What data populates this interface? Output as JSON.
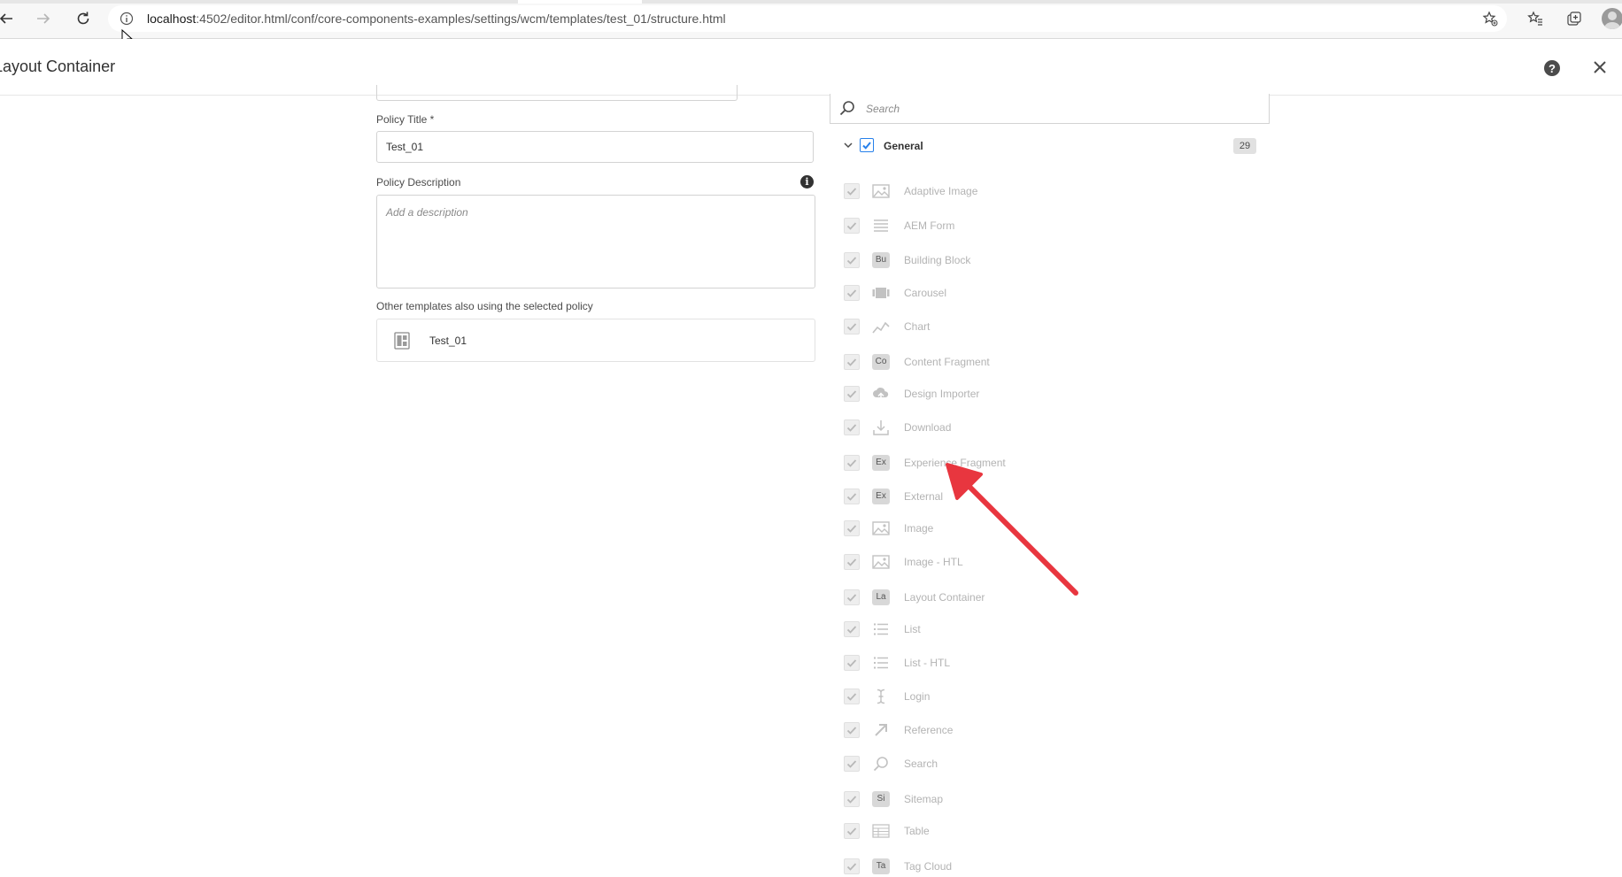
{
  "browser": {
    "url_host": "localhost",
    "url_rest": ":4502/editor.html/conf/core-components-examples/settings/wcm/templates/test_01/structure.html"
  },
  "dialog": {
    "title": "Layout Container"
  },
  "form": {
    "policy_title_label": "Policy Title *",
    "policy_title_value": "Test_01",
    "policy_description_label": "Policy Description",
    "policy_description_placeholder": "Add a description",
    "other_templates_label": "Other templates also using the selected policy",
    "other_templates": [
      {
        "name": "Test_01"
      }
    ]
  },
  "components": {
    "search_placeholder": "Search",
    "group": {
      "name": "General",
      "count": "29",
      "checked": true
    },
    "items": [
      {
        "label": "Adaptive Image",
        "icon": "image-icon",
        "abbr": ""
      },
      {
        "label": "AEM Form",
        "icon": "form-icon",
        "abbr": ""
      },
      {
        "label": "Building Block",
        "icon": "abbr",
        "abbr": "Bu"
      },
      {
        "label": "Carousel",
        "icon": "carousel-icon",
        "abbr": ""
      },
      {
        "label": "Chart",
        "icon": "chart-icon",
        "abbr": ""
      },
      {
        "label": "Content Fragment",
        "icon": "abbr",
        "abbr": "Co"
      },
      {
        "label": "Design Importer",
        "icon": "cloud-upload-icon",
        "abbr": ""
      },
      {
        "label": "Download",
        "icon": "download-icon",
        "abbr": ""
      },
      {
        "label": "Experience Fragment",
        "icon": "abbr",
        "abbr": "Ex"
      },
      {
        "label": "External",
        "icon": "abbr",
        "abbr": "Ex"
      },
      {
        "label": "Image",
        "icon": "image-icon",
        "abbr": ""
      },
      {
        "label": "Image - HTL",
        "icon": "image-icon",
        "abbr": ""
      },
      {
        "label": "Layout Container",
        "icon": "abbr",
        "abbr": "La"
      },
      {
        "label": "List",
        "icon": "list-icon",
        "abbr": ""
      },
      {
        "label": "List - HTL",
        "icon": "list-icon",
        "abbr": ""
      },
      {
        "label": "Login",
        "icon": "text-cursor-icon",
        "abbr": ""
      },
      {
        "label": "Reference",
        "icon": "reference-arrow-icon",
        "abbr": ""
      },
      {
        "label": "Search",
        "icon": "search-icon",
        "abbr": ""
      },
      {
        "label": "Sitemap",
        "icon": "abbr",
        "abbr": "Si"
      },
      {
        "label": "Table",
        "icon": "table-icon",
        "abbr": ""
      },
      {
        "label": "Tag Cloud",
        "icon": "abbr",
        "abbr": "Ta"
      }
    ]
  },
  "colors": {
    "accent": "#2680eb",
    "annotation_arrow": "#e8363f",
    "disabled_text": "#b3b3b3"
  }
}
